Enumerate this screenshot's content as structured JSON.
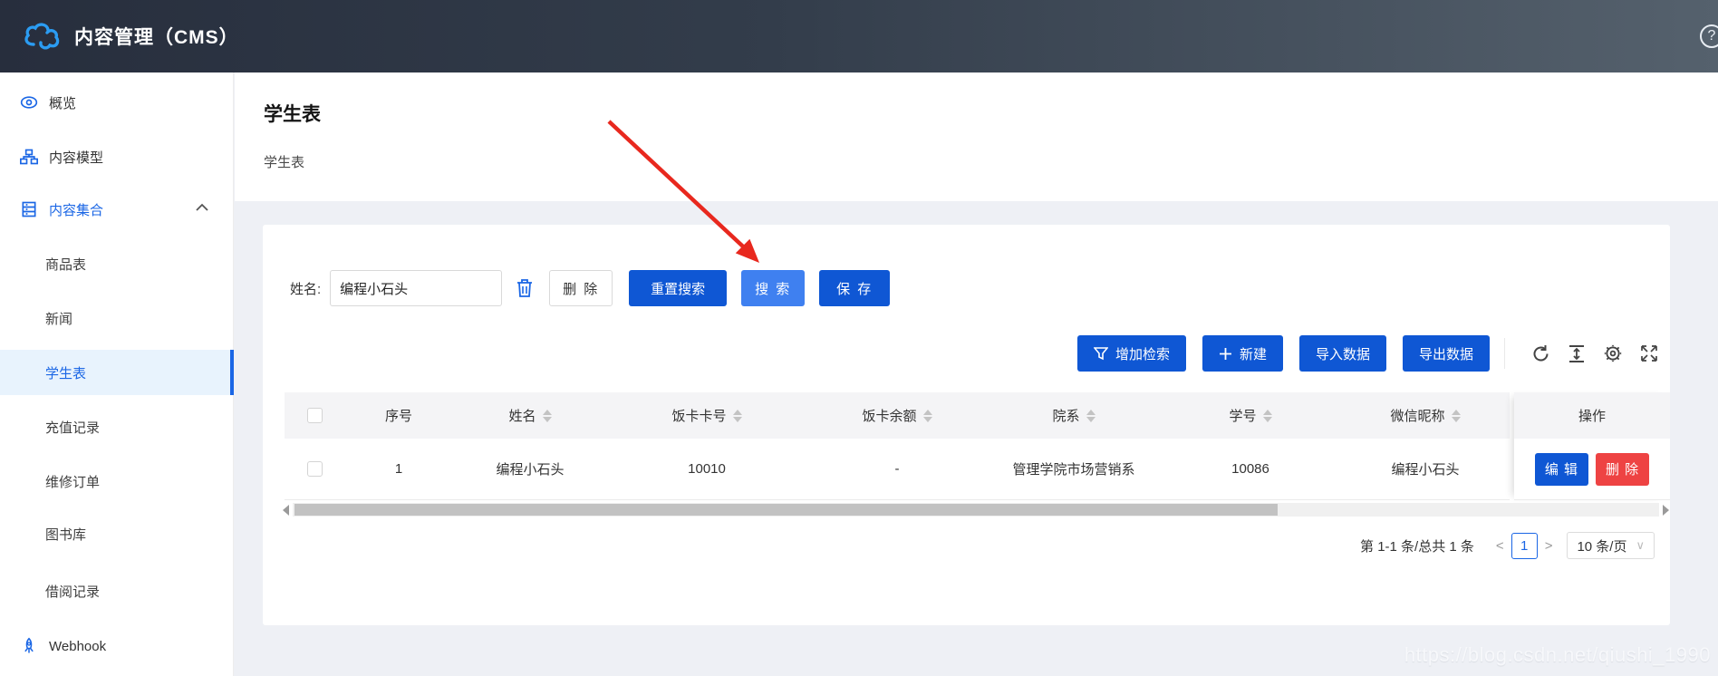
{
  "header": {
    "title": "内容管理（CMS）",
    "help": "?"
  },
  "sidebar": {
    "items": [
      {
        "label": "概览"
      },
      {
        "label": "内容模型"
      },
      {
        "label": "内容集合"
      },
      {
        "label": "商品表"
      },
      {
        "label": "新闻"
      },
      {
        "label": "学生表"
      },
      {
        "label": "充值记录"
      },
      {
        "label": "维修订单"
      },
      {
        "label": "图书库"
      },
      {
        "label": "借阅记录"
      },
      {
        "label": "Webhook"
      }
    ]
  },
  "page": {
    "title": "学生表",
    "subtitle": "学生表"
  },
  "search": {
    "name_label": "姓名:",
    "name_value": "编程小石头",
    "delete_label": "删 除",
    "reset_label": "重置搜索",
    "search_label": "搜 索",
    "save_label": "保 存"
  },
  "toolbar": {
    "add_filter": "增加检索",
    "create": "新建",
    "import": "导入数据",
    "export": "导出数据"
  },
  "table": {
    "columns": [
      "序号",
      "姓名",
      "饭卡卡号",
      "饭卡余额",
      "院系",
      "学号",
      "微信昵称"
    ],
    "action_column": "操作",
    "rows": [
      {
        "seq": "1",
        "name": "编程小石头",
        "card_no": "10010",
        "balance": "-",
        "department": "管理学院市场营销系",
        "student_no": "10086",
        "wechat": "编程小石头",
        "edit_label": "编 辑",
        "delete_label": "删 除"
      }
    ]
  },
  "pagination": {
    "info": "第 1-1 条/总共 1 条",
    "prev": "<",
    "current": "1",
    "next": ">",
    "page_size": "10 条/页"
  },
  "watermark": "https://blog.csdn.net/qiushi_1990",
  "colors": {
    "primary_blue": "#0f57d4",
    "link_blue": "#1a66e5",
    "danger_red": "#ee4343",
    "arrow_red": "#e8281e",
    "selected_bg": "#e8f3fd",
    "page_bg": "#eef0f5",
    "header_grad_start": "#272e3d",
    "header_grad_end": "#55616d"
  }
}
